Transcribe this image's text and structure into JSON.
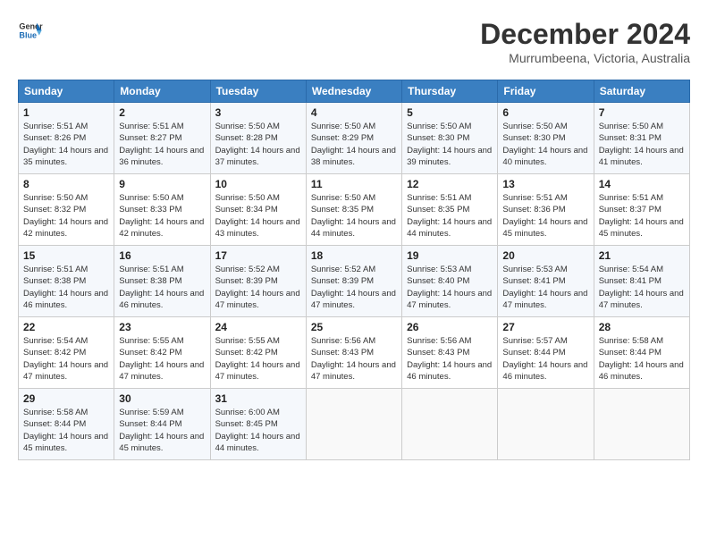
{
  "header": {
    "logo_line1": "General",
    "logo_line2": "Blue",
    "month_title": "December 2024",
    "location": "Murrumbeena, Victoria, Australia"
  },
  "days_of_week": [
    "Sunday",
    "Monday",
    "Tuesday",
    "Wednesday",
    "Thursday",
    "Friday",
    "Saturday"
  ],
  "weeks": [
    [
      {
        "day": "1",
        "sunrise": "5:51 AM",
        "sunset": "8:26 PM",
        "daylight": "14 hours and 35 minutes."
      },
      {
        "day": "2",
        "sunrise": "5:51 AM",
        "sunset": "8:27 PM",
        "daylight": "14 hours and 36 minutes."
      },
      {
        "day": "3",
        "sunrise": "5:50 AM",
        "sunset": "8:28 PM",
        "daylight": "14 hours and 37 minutes."
      },
      {
        "day": "4",
        "sunrise": "5:50 AM",
        "sunset": "8:29 PM",
        "daylight": "14 hours and 38 minutes."
      },
      {
        "day": "5",
        "sunrise": "5:50 AM",
        "sunset": "8:30 PM",
        "daylight": "14 hours and 39 minutes."
      },
      {
        "day": "6",
        "sunrise": "5:50 AM",
        "sunset": "8:30 PM",
        "daylight": "14 hours and 40 minutes."
      },
      {
        "day": "7",
        "sunrise": "5:50 AM",
        "sunset": "8:31 PM",
        "daylight": "14 hours and 41 minutes."
      }
    ],
    [
      {
        "day": "8",
        "sunrise": "5:50 AM",
        "sunset": "8:32 PM",
        "daylight": "14 hours and 42 minutes."
      },
      {
        "day": "9",
        "sunrise": "5:50 AM",
        "sunset": "8:33 PM",
        "daylight": "14 hours and 42 minutes."
      },
      {
        "day": "10",
        "sunrise": "5:50 AM",
        "sunset": "8:34 PM",
        "daylight": "14 hours and 43 minutes."
      },
      {
        "day": "11",
        "sunrise": "5:50 AM",
        "sunset": "8:35 PM",
        "daylight": "14 hours and 44 minutes."
      },
      {
        "day": "12",
        "sunrise": "5:51 AM",
        "sunset": "8:35 PM",
        "daylight": "14 hours and 44 minutes."
      },
      {
        "day": "13",
        "sunrise": "5:51 AM",
        "sunset": "8:36 PM",
        "daylight": "14 hours and 45 minutes."
      },
      {
        "day": "14",
        "sunrise": "5:51 AM",
        "sunset": "8:37 PM",
        "daylight": "14 hours and 45 minutes."
      }
    ],
    [
      {
        "day": "15",
        "sunrise": "5:51 AM",
        "sunset": "8:38 PM",
        "daylight": "14 hours and 46 minutes."
      },
      {
        "day": "16",
        "sunrise": "5:51 AM",
        "sunset": "8:38 PM",
        "daylight": "14 hours and 46 minutes."
      },
      {
        "day": "17",
        "sunrise": "5:52 AM",
        "sunset": "8:39 PM",
        "daylight": "14 hours and 47 minutes."
      },
      {
        "day": "18",
        "sunrise": "5:52 AM",
        "sunset": "8:39 PM",
        "daylight": "14 hours and 47 minutes."
      },
      {
        "day": "19",
        "sunrise": "5:53 AM",
        "sunset": "8:40 PM",
        "daylight": "14 hours and 47 minutes."
      },
      {
        "day": "20",
        "sunrise": "5:53 AM",
        "sunset": "8:41 PM",
        "daylight": "14 hours and 47 minutes."
      },
      {
        "day": "21",
        "sunrise": "5:54 AM",
        "sunset": "8:41 PM",
        "daylight": "14 hours and 47 minutes."
      }
    ],
    [
      {
        "day": "22",
        "sunrise": "5:54 AM",
        "sunset": "8:42 PM",
        "daylight": "14 hours and 47 minutes."
      },
      {
        "day": "23",
        "sunrise": "5:55 AM",
        "sunset": "8:42 PM",
        "daylight": "14 hours and 47 minutes."
      },
      {
        "day": "24",
        "sunrise": "5:55 AM",
        "sunset": "8:42 PM",
        "daylight": "14 hours and 47 minutes."
      },
      {
        "day": "25",
        "sunrise": "5:56 AM",
        "sunset": "8:43 PM",
        "daylight": "14 hours and 47 minutes."
      },
      {
        "day": "26",
        "sunrise": "5:56 AM",
        "sunset": "8:43 PM",
        "daylight": "14 hours and 46 minutes."
      },
      {
        "day": "27",
        "sunrise": "5:57 AM",
        "sunset": "8:44 PM",
        "daylight": "14 hours and 46 minutes."
      },
      {
        "day": "28",
        "sunrise": "5:58 AM",
        "sunset": "8:44 PM",
        "daylight": "14 hours and 46 minutes."
      }
    ],
    [
      {
        "day": "29",
        "sunrise": "5:58 AM",
        "sunset": "8:44 PM",
        "daylight": "14 hours and 45 minutes."
      },
      {
        "day": "30",
        "sunrise": "5:59 AM",
        "sunset": "8:44 PM",
        "daylight": "14 hours and 45 minutes."
      },
      {
        "day": "31",
        "sunrise": "6:00 AM",
        "sunset": "8:45 PM",
        "daylight": "14 hours and 44 minutes."
      },
      null,
      null,
      null,
      null
    ]
  ]
}
